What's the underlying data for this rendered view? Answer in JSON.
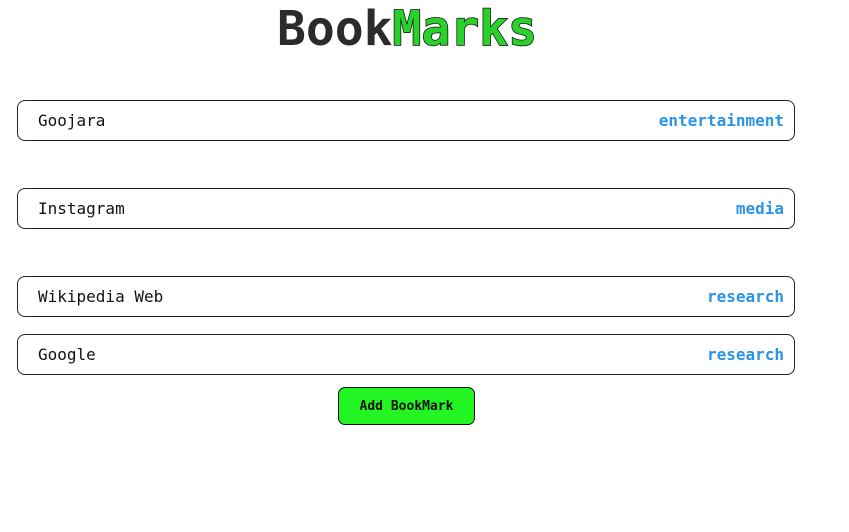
{
  "header": {
    "title_part_1": "Book",
    "title_part_2": "Marks"
  },
  "bookmarks": [
    {
      "name": "Goojara",
      "category": "entertainment"
    },
    {
      "name": "Instagram",
      "category": "media"
    },
    {
      "name": "Wikipedia Web",
      "category": "research"
    },
    {
      "name": "Google",
      "category": "research"
    }
  ],
  "actions": {
    "add_label": "Add BookMark"
  },
  "colors": {
    "accent_green": "#22f522",
    "category_blue": "#2b94e6",
    "title_dark": "#2b2b2b"
  }
}
